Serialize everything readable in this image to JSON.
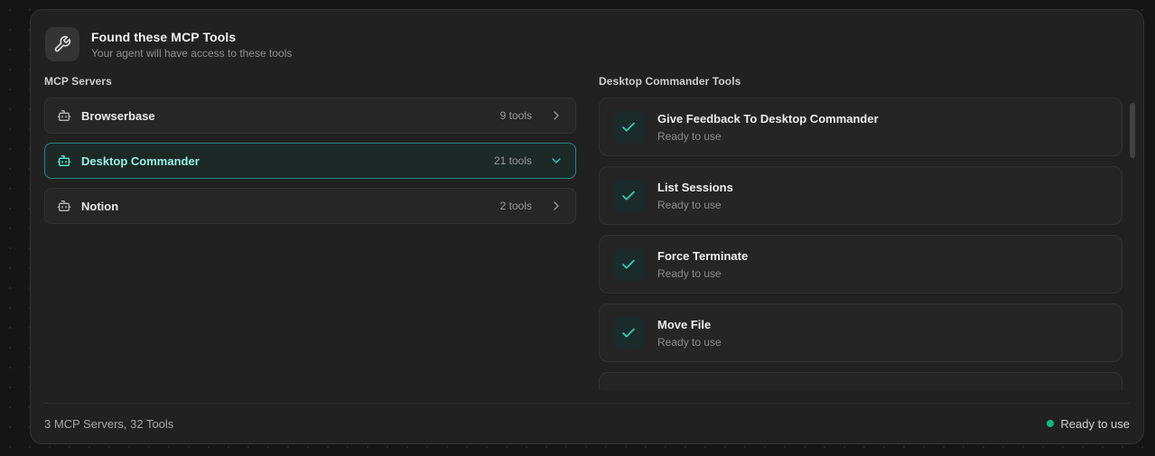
{
  "header": {
    "title": "Found these MCP Tools",
    "subtitle": "Your agent will have access to these tools"
  },
  "servers_panel": {
    "heading": "MCP Servers",
    "servers": [
      {
        "name": "Browserbase",
        "tools_count": "9 tools",
        "state": "collapsed"
      },
      {
        "name": "Desktop Commander",
        "tools_count": "21 tools",
        "state": "expanded"
      },
      {
        "name": "Notion",
        "tools_count": "2 tools",
        "state": "collapsed"
      }
    ]
  },
  "tools_panel": {
    "heading": "Desktop Commander Tools",
    "tools": [
      {
        "name": "Give Feedback To Desktop Commander",
        "status": "Ready to use"
      },
      {
        "name": "List Sessions",
        "status": "Ready to use"
      },
      {
        "name": "Force Terminate",
        "status": "Ready to use"
      },
      {
        "name": "Move File",
        "status": "Ready to use"
      }
    ]
  },
  "footer": {
    "summary": "3 MCP Servers, 32 Tools",
    "status_label": "Ready to use"
  },
  "colors": {
    "accent_teal": "#2dd4bf",
    "selected_text_teal": "#99f0e0",
    "status_green": "#10b981",
    "panel_background": "#212121",
    "card_background": "#252525"
  }
}
